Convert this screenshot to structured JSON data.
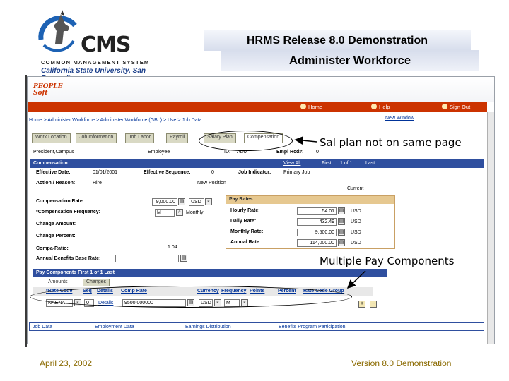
{
  "slide": {
    "logo": {
      "name": "CMS",
      "subtitle": "COMMON MANAGEMENT SYSTEM",
      "university": "California State University, San Bernardino"
    },
    "title": "HRMS Release 8.0 Demonstration",
    "subtitle": "Administer Workforce",
    "footer_date": "April 23, 2002",
    "footer_version": "Version 8.0 Demonstration"
  },
  "callouts": {
    "sal_plan": "Sal plan not on same page",
    "multiple": "Multiple Pay Components"
  },
  "ps": {
    "logo_line1": "PEOPLE",
    "logo_line2": "Soft",
    "nav": {
      "home": "Home",
      "help": "Help",
      "signout": "Sign Out"
    },
    "new_window": "New Window",
    "breadcrumb": "Home > Administer Workforce > Administer Workforce (GBL) > Use > Job Data",
    "tabs": [
      "Work Location",
      "Job Information",
      "Job Labor",
      "Payroll",
      "Salary Plan",
      "Compensation"
    ],
    "employee": {
      "name": "President,Campus",
      "emp_label": "Employee",
      "id_label": "ID:",
      "id_value": "ADM",
      "empl_rcd_label": "Empl Rcd#:",
      "empl_rcd_value": "0"
    },
    "comp_bar": {
      "title": "Compensation",
      "view_all": "View All",
      "first": "First",
      "of": "1 of 1",
      "last": "Last"
    },
    "fields": {
      "effective_date_label": "Effective Date:",
      "effective_date": "01/01/2001",
      "eff_seq_label": "Effective Sequence:",
      "eff_seq": "0",
      "job_indicator_label": "Job Indicator:",
      "job_indicator": "Primary Job",
      "action_label": "Action / Reason:",
      "action": "Hire",
      "reason": "New Position",
      "current": "Current",
      "comp_rate_label": "Compensation Rate:",
      "comp_rate": "9,000.00",
      "currency": "USD",
      "comp_freq_label": "*Compensation Frequency:",
      "comp_freq": "M",
      "comp_freq_desc": "Monthly",
      "change_amount_label": "Change Amount:",
      "change_percent_label": "Change Percent:",
      "compa_ratio_label": "Compa-Ratio:",
      "compa_ratio": "1.04",
      "annual_benefits_label": "Annual Benefits Base Rate:"
    },
    "pay_rates": {
      "title": "Pay Rates",
      "rows": [
        {
          "label": "Hourly Rate:",
          "value": "54.01",
          "cur": "USD"
        },
        {
          "label": "Daily Rate:",
          "value": "432.49",
          "cur": "USD"
        },
        {
          "label": "Monthly Rate:",
          "value": "9,500.00",
          "cur": "USD"
        },
        {
          "label": "Annual Rate:",
          "value": "114,000.00",
          "cur": "USD"
        }
      ]
    },
    "pay_components": {
      "title": "Pay Components",
      "first": "First",
      "of": "1 of 1",
      "last": "Last",
      "subtabs": [
        "Amounts",
        "Changes"
      ],
      "columns": [
        "*Rate Code",
        "Seq",
        "Details",
        "Comp Rate",
        "Currency",
        "Frequency",
        "Points",
        "Percent",
        "Rate Code Group"
      ],
      "row": {
        "rate_code": "NAENA",
        "seq": "0",
        "details": "Details",
        "comp_rate": "9500.000000",
        "currency": "USD",
        "frequency": "M"
      }
    },
    "bottom_links": [
      "Job Data",
      "Employment Data",
      "Earnings Distribution",
      "Benefits Program Participation"
    ]
  }
}
